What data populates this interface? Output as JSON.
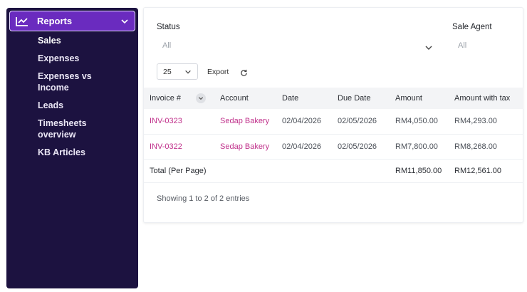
{
  "sidebar": {
    "header": {
      "label": "Reports",
      "icon": "line-chart-icon"
    },
    "items": [
      {
        "label": "Sales",
        "active": true
      },
      {
        "label": "Expenses"
      },
      {
        "label": "Expenses vs Income"
      },
      {
        "label": "Leads"
      },
      {
        "label": "Timesheets overview"
      },
      {
        "label": "KB Articles"
      }
    ]
  },
  "filters": {
    "status": {
      "label": "Status",
      "value": "All"
    },
    "sale_agent": {
      "label": "Sale Agent",
      "value": "All"
    }
  },
  "toolbar": {
    "per_page": "25",
    "export_label": "Export"
  },
  "table": {
    "columns": [
      "Invoice #",
      "Account",
      "Date",
      "Due Date",
      "Amount",
      "Amount with tax"
    ],
    "rows": [
      {
        "invoice": "INV-0323",
        "account": "Sedap Bakery",
        "date": "02/04/2026",
        "due": "02/05/2026",
        "amount": "RM4,050.00",
        "amount_tax": "RM4,293.00"
      },
      {
        "invoice": "INV-0322",
        "account": "Sedap Bakery",
        "date": "02/04/2026",
        "due": "02/05/2026",
        "amount": "RM7,800.00",
        "amount_tax": "RM8,268.00"
      }
    ],
    "total": {
      "label": "Total (Per Page)",
      "amount": "RM11,850.00",
      "amount_tax": "RM12,561.00"
    }
  },
  "footer": {
    "entries_text": "Showing 1 to 2 of 2 entries"
  },
  "colors": {
    "sidebar_bg": "#1c1240",
    "accent": "#6a2bbf",
    "link": "#c0318b"
  }
}
